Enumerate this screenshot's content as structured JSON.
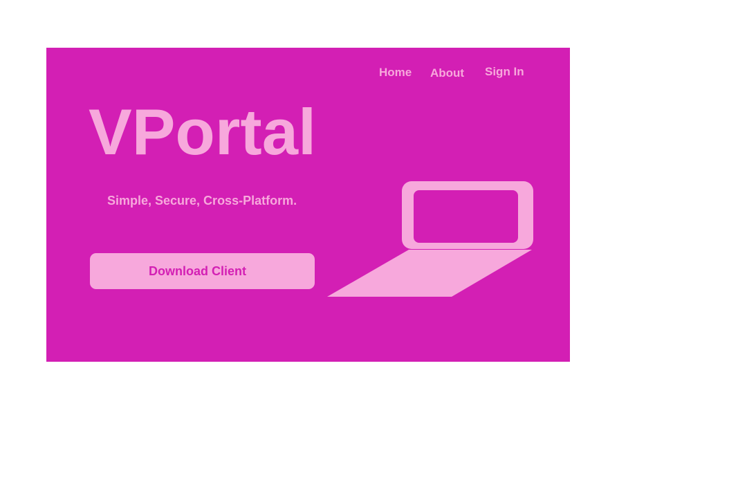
{
  "nav": {
    "home_label": "Home",
    "about_label": "About",
    "signin_label": "Sign In"
  },
  "hero": {
    "title": "VPortal",
    "tagline": "Simple, Secure, Cross-Platform.",
    "download_label": "Download Client",
    "illustration_icon": "laptop-icon"
  },
  "colors": {
    "page_background": "#ffffff",
    "hero_background": "#d31fb4",
    "accent_light": "#f7a8dc",
    "button_text": "#d31fb4"
  }
}
